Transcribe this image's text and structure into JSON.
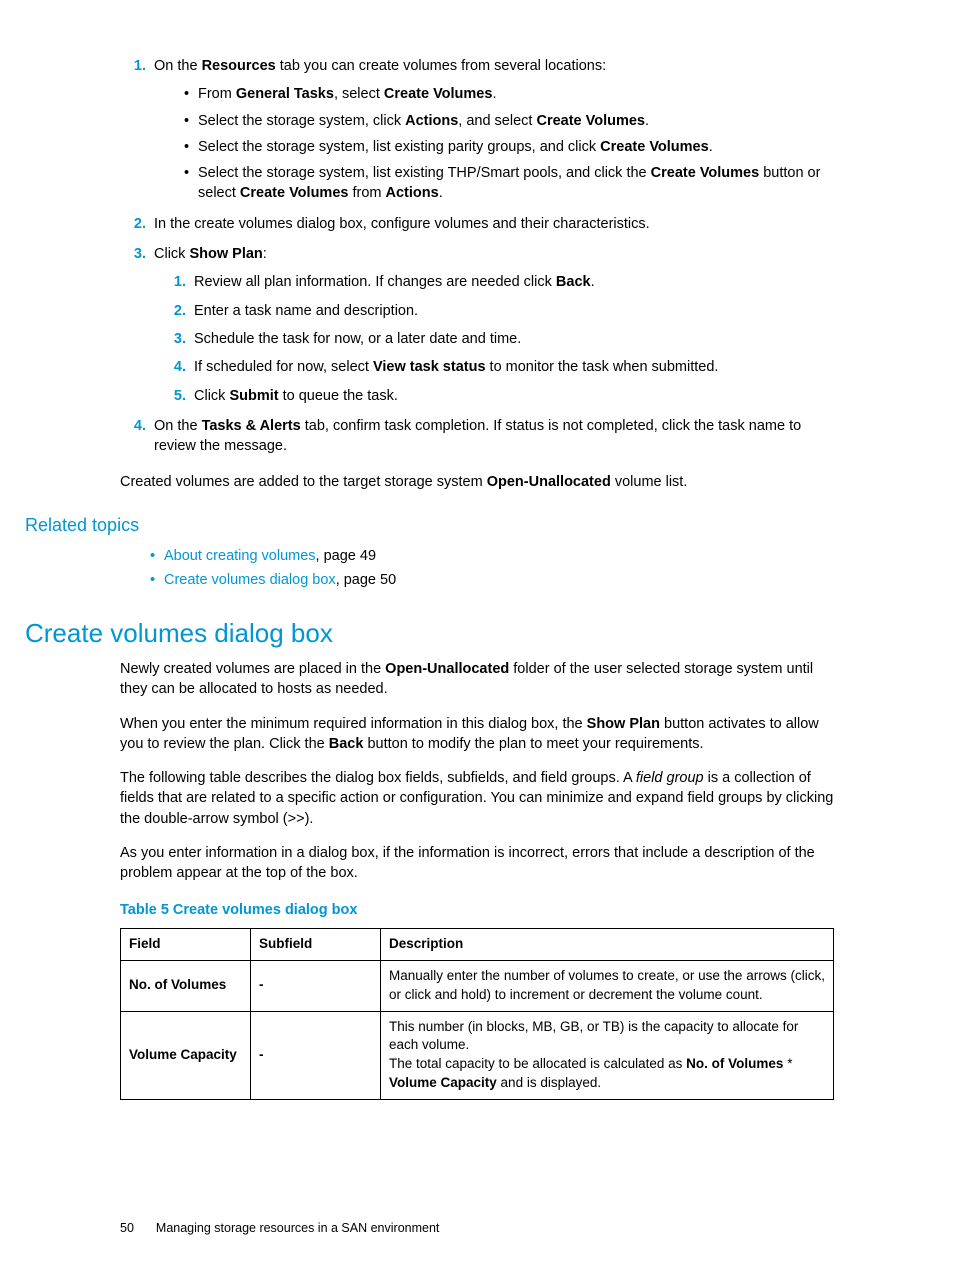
{
  "steps": {
    "s1_lead": "On the ",
    "s1_tab": "Resources",
    "s1_tail": " tab you can create volumes from several locations:",
    "s1_bullets": [
      {
        "pre": "From ",
        "b1": "General Tasks",
        "mid": ", select ",
        "b2": "Create Volumes",
        "post": "."
      },
      {
        "pre": "Select the storage system, click ",
        "b1": "Actions",
        "mid": ", and select ",
        "b2": "Create Volumes",
        "post": "."
      },
      {
        "pre": "Select the storage system, list existing parity groups, and click ",
        "b1": "Create Volumes",
        "mid": "",
        "b2": "",
        "post": "."
      },
      {
        "pre": "Select the storage system, list existing THP/Smart pools, and click the ",
        "b1": "Create Volumes",
        "mid": " button or select ",
        "b2": "Create Volumes",
        "post": " from ",
        "b3": "Actions",
        "post2": "."
      }
    ],
    "s2": "In the create volumes dialog box, configure volumes and their characteristics.",
    "s3_lead": "Click ",
    "s3_b": "Show Plan",
    "s3_tail": ":",
    "s3_sub": [
      {
        "pre": "Review all plan information. If changes are needed click ",
        "b": "Back",
        "post": "."
      },
      {
        "pre": "Enter a task name and description.",
        "b": "",
        "post": ""
      },
      {
        "pre": "Schedule the task for now, or a later date and time.",
        "b": "",
        "post": ""
      },
      {
        "pre": "If scheduled for now, select ",
        "b": "View task status",
        "post": " to monitor the task when submitted."
      },
      {
        "pre": "Click ",
        "b": "Submit",
        "post": " to queue the task."
      }
    ],
    "s4_pre": "On the ",
    "s4_b": "Tasks & Alerts",
    "s4_post": " tab, confirm task completion. If status is not completed, click the task name to review the message."
  },
  "after_steps_pre": "Created volumes are added to the target storage system ",
  "after_steps_b": "Open-Unallocated",
  "after_steps_post": " volume list.",
  "related_heading": "Related topics",
  "related": [
    {
      "link": "About creating volumes",
      "rest": ", page 49"
    },
    {
      "link": "Create volumes dialog box",
      "rest": ", page 50"
    }
  ],
  "section_title": "Create volumes dialog box",
  "p1_pre": "Newly created volumes are placed in the ",
  "p1_b": "Open-Unallocated",
  "p1_post": " folder of the user selected storage system until they can be allocated to hosts as needed.",
  "p2_pre": "When you enter the minimum required information in this dialog box, the  ",
  "p2_b1": "Show Plan",
  "p2_mid": " button activates to allow you to review the plan. Click the ",
  "p2_b2": "Back",
  "p2_post": " button to modify the plan to meet your requirements.",
  "p3_pre": "The following table describes the dialog box fields, subfields, and field groups. A ",
  "p3_i": "field group",
  "p3_post": " is a collection of fields that are related to a specific action or configuration. You can minimize and expand field groups by clicking the double-arrow symbol (>>).",
  "p4": "As you enter information in a dialog box, if the information is incorrect, errors that include a description of the problem appear at the top of the box.",
  "table_caption": "Table 5 Create volumes dialog box",
  "table": {
    "headers": [
      "Field",
      "Subfield",
      "Description"
    ],
    "rows": [
      {
        "field": "No. of Volumes",
        "subfield": "-",
        "desc": "Manually enter the number of volumes to create, or use the arrows (click, or click and hold) to increment or decrement the volume count."
      },
      {
        "field": "Volume Capacity",
        "subfield": "-",
        "desc_line1": "This number (in blocks, MB, GB, or TB) is the capacity to allocate for each volume.",
        "desc_line2_pre": "The total capacity to be allocated is calculated as ",
        "desc_line2_b1": "No. of Volumes",
        "desc_line2_mid": " * ",
        "desc_line2_b2": "Volume Capacity",
        "desc_line2_post": " and is displayed."
      }
    ]
  },
  "footer": {
    "page": "50",
    "title": "Managing storage resources in a SAN environment"
  }
}
